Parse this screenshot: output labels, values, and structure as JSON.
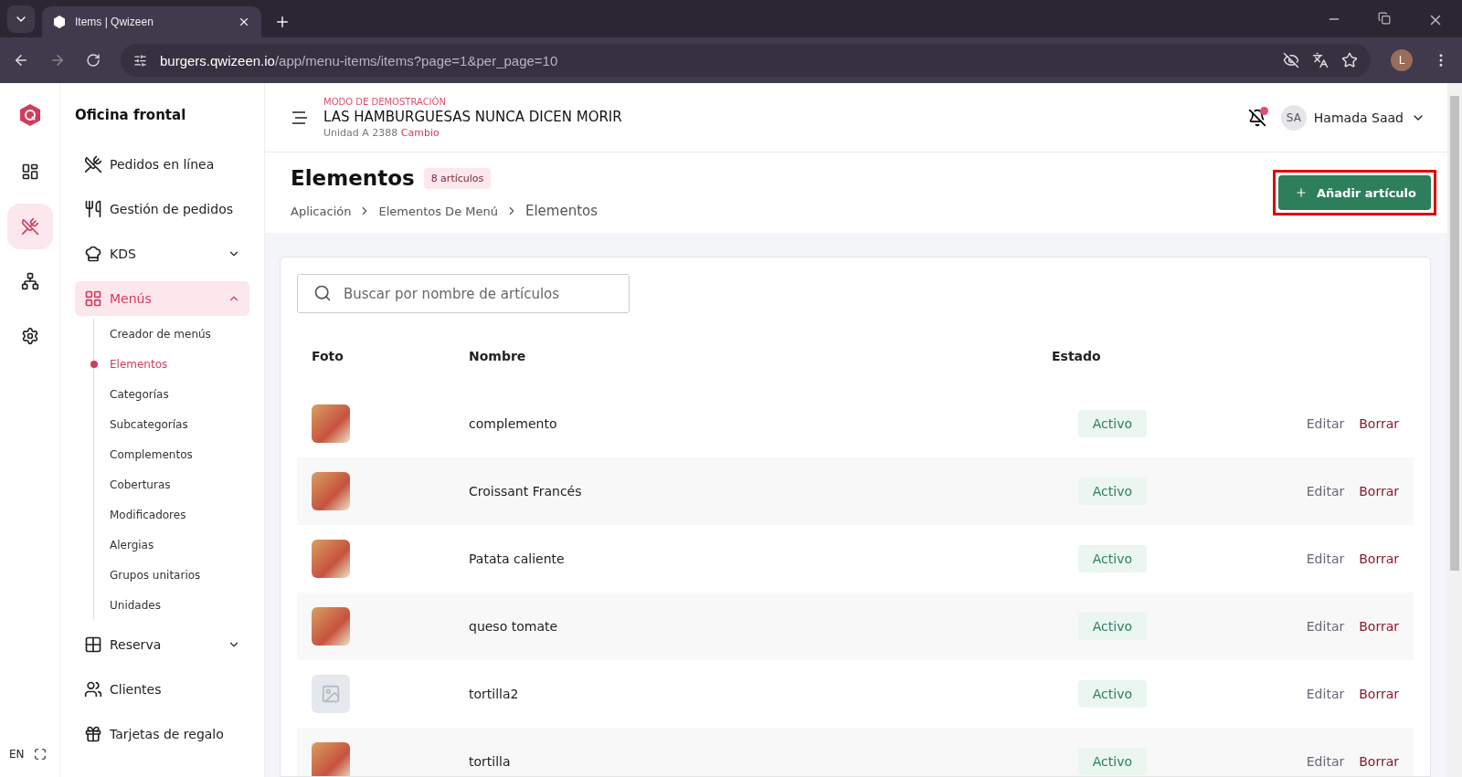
{
  "browser": {
    "tab_title": "Items | Qwizeen",
    "url_host": "burgers.qwizeen.io",
    "url_path": "/app/menu-items/items?page=1&per_page=10",
    "profile_initial": "L"
  },
  "rail": {
    "items": [
      {
        "selected": false
      },
      {
        "selected": true
      },
      {
        "selected": false
      },
      {
        "selected": false
      }
    ],
    "language": "EN"
  },
  "sidebar": {
    "title": "Oficina frontal",
    "items": [
      {
        "label": "Pedidos en línea",
        "selected": false
      },
      {
        "label": "Gestión de pedidos",
        "selected": false
      },
      {
        "label": "KDS",
        "selected": false,
        "expanded": false
      },
      {
        "label": "Menús",
        "selected": true,
        "expanded": true,
        "children": [
          {
            "label": "Creador de menús",
            "selected": false
          },
          {
            "label": "Elementos",
            "selected": true
          },
          {
            "label": "Categorías",
            "selected": false
          },
          {
            "label": "Subcategorías",
            "selected": false
          },
          {
            "label": "Complementos",
            "selected": false
          },
          {
            "label": "Coberturas",
            "selected": false
          },
          {
            "label": "Modificadores",
            "selected": false
          },
          {
            "label": "Alergias",
            "selected": false
          },
          {
            "label": "Grupos unitarios",
            "selected": false
          },
          {
            "label": "Unidades",
            "selected": false
          }
        ]
      },
      {
        "label": "Reserva",
        "selected": false,
        "expanded": false
      },
      {
        "label": "Clientes",
        "selected": false
      },
      {
        "label": "Tarjetas de regalo",
        "selected": false
      }
    ]
  },
  "header": {
    "mode": "MODO DE DEMOSTRACIÓN",
    "restaurant": "LAS HAMBURGUESAS NUNCA DICEN MORIR",
    "unit": "Unidad A 2388",
    "change_link": "Cambio",
    "user_initials": "SA",
    "user_name": "Hamada Saad"
  },
  "page": {
    "title": "Elementos",
    "count_badge": "8 artículos",
    "breadcrumbs": [
      "Aplicación",
      "Elementos De Menú",
      "Elementos"
    ],
    "add_button": "Añadir artículo",
    "search": {
      "placeholder": "Buscar por nombre de artículos"
    }
  },
  "table": {
    "columns": [
      "Foto",
      "Nombre",
      "Estado"
    ],
    "rows": [
      {
        "has_photo": true,
        "name": "complemento",
        "status": "Activo",
        "edit": "Editar",
        "delete": "Borrar"
      },
      {
        "has_photo": true,
        "name": "Croissant Francés",
        "status": "Activo",
        "edit": "Editar",
        "delete": "Borrar"
      },
      {
        "has_photo": true,
        "name": "Patata caliente",
        "status": "Activo",
        "edit": "Editar",
        "delete": "Borrar"
      },
      {
        "has_photo": true,
        "name": "queso tomate",
        "status": "Activo",
        "edit": "Editar",
        "delete": "Borrar"
      },
      {
        "has_photo": false,
        "name": "tortilla2",
        "status": "Activo",
        "edit": "Editar",
        "delete": "Borrar"
      },
      {
        "has_photo": true,
        "name": "tortilla",
        "status": "Activo",
        "edit": "Editar",
        "delete": "Borrar"
      }
    ]
  }
}
